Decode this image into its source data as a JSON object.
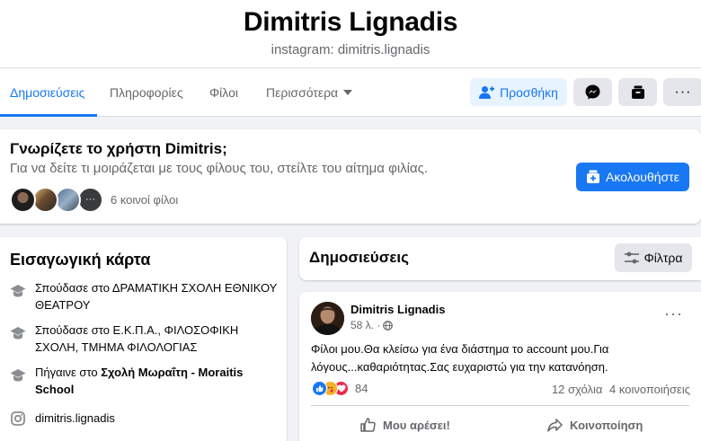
{
  "profile": {
    "name": "Dimitris Lignadis",
    "subtitle": "instagram: dimitris.lignadis"
  },
  "tabs": [
    {
      "label": "Δημοσιεύσεις",
      "active": true
    },
    {
      "label": "Πληροφορίες"
    },
    {
      "label": "Φίλοι"
    },
    {
      "label": "Περισσότερα"
    }
  ],
  "actions": {
    "add_label": "Προσθήκη"
  },
  "know_card": {
    "title": "Γνωρίζετε το χρήστη Dimitris;",
    "description": "Για να δείτε τι μοιράζεται με τους φίλους του, στείλτε του αίτημα φιλίας.",
    "mutual_friends": "6 κοινοί φίλοι",
    "follow_label": "Ακολουθήστε"
  },
  "intro": {
    "title": "Εισαγωγική κάρτα",
    "items": [
      {
        "prefix": "Σπούδασε στο ",
        "value": "ΔΡΑΜΑΤΙΚΗ ΣΧΟΛΗ ΕΘΝΙΚΟΥ ΘΕΑΤΡΟΥ"
      },
      {
        "prefix": "Σπούδασε στο ",
        "value": "Ε.Κ.Π.Α., ΦΙΛΟΣΟΦΙΚΗ ΣΧΟΛΗ, ΤΜΗΜΑ ΦΙΛΟΛΟΓΙΑΣ"
      },
      {
        "prefix": "Πήγαινε στο ",
        "value": "Σχολή Μωραΐτη - Moraitis School"
      }
    ],
    "instagram": "dimitris.lignadis"
  },
  "posts": {
    "title": "Δημοσιεύσεις",
    "filter_label": "Φίλτρα"
  },
  "post": {
    "author": "Dimitris Lignadis",
    "time": "58 λ. ·",
    "text": "Φίλοι μου.Θα κλείσω για ένα διάστημα το account μου.Για λόγους...καθαριότητας.Σας ευχαριστώ για την κατανόηση.",
    "reaction_count": "84",
    "comments": "12 σχόλια",
    "shares": "4 κοινοποιήσεις",
    "like_label": "Μου αρέσει!",
    "share_label": "Κοινοποίηση"
  },
  "colors": {
    "accent": "#1877f2",
    "secondary_text": "#65676b",
    "background": "#f0f2f5"
  }
}
